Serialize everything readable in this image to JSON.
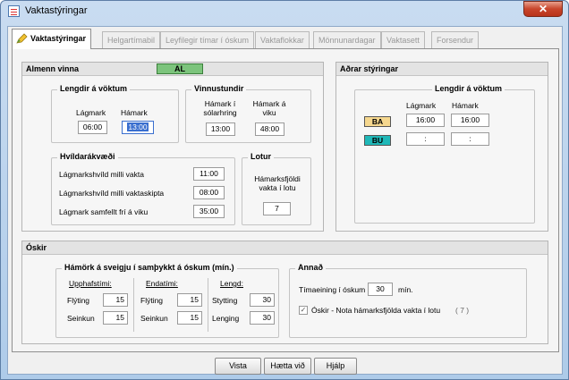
{
  "window": {
    "title": "Vaktastýringar",
    "close_glyph": "✕"
  },
  "tabs": [
    {
      "label": "Vaktastýringar"
    },
    {
      "label": "Helgartímabil"
    },
    {
      "label": "Leyfilegir tímar í óskum"
    },
    {
      "label": "Vaktaflokkar"
    },
    {
      "label": "Mönnunardagar"
    },
    {
      "label": "Vaktasett"
    },
    {
      "label": "Forsendur"
    }
  ],
  "almenn": {
    "title": "Almenn vinna",
    "badge": "AL",
    "lengdir": {
      "title": "Lengdir á vöktum",
      "min_label": "Lágmark",
      "max_label": "Hámark",
      "min_value": "06:00",
      "max_value": "13:00"
    },
    "vinnustundir": {
      "title": "Vinnustundir",
      "day_label": "Hámark í sólarhring",
      "week_label": "Hámark á viku",
      "day_value": "13:00",
      "week_value": "48:00"
    },
    "hvildar": {
      "title": "Hvíldarákvæði",
      "rows": [
        {
          "label": "Lágmarkshvíld milli vakta",
          "value": "11:00"
        },
        {
          "label": "Lágmarkshvíld milli vaktaskipta",
          "value": "08:00"
        },
        {
          "label": "Lágmark samfellt frí á viku",
          "value": "35:00"
        }
      ]
    },
    "lotur": {
      "title": "Lotur",
      "label": "Hámarksfjöldi vakta í lotu",
      "value": "7"
    }
  },
  "adrar": {
    "title": "Aðrar stýringar",
    "lengdir_title": "Lengdir á vöktum",
    "min_label": "Lágmark",
    "max_label": "Hámark",
    "rows": [
      {
        "tag": "BA",
        "min": "16:00",
        "max": "16:00",
        "color": "#f5d78e"
      },
      {
        "tag": "BU",
        "min": ":",
        "max": ":",
        "color": "#1fb8b8"
      }
    ]
  },
  "oskir": {
    "title": "Óskir",
    "hamork": {
      "title": "Hámörk á sveigju í samþykkt á óskum (mín.)",
      "upphaf": {
        "title": "Upphafstími:",
        "r1_label": "Flýting",
        "r1_value": "15",
        "r2_label": "Seinkun",
        "r2_value": "15"
      },
      "enda": {
        "title": "Endatími:",
        "r1_label": "Flýting",
        "r1_value": "15",
        "r2_label": "Seinkun",
        "r2_value": "15"
      },
      "lengd": {
        "title": "Lengd:",
        "r1_label": "Stytting",
        "r1_value": "30",
        "r2_label": "Lenging",
        "r2_value": "30"
      }
    },
    "annad": {
      "title": "Annað",
      "time_label": "Tímaeining í óskum",
      "time_value": "30",
      "time_unit": "mín.",
      "check_label": "Óskir - Nota hámarksfjölda vakta í lotu",
      "check_value": "( 7 )",
      "check_glyph": "✓"
    }
  },
  "buttons": {
    "vista": "Vista",
    "haetta": "Hætta við",
    "hjalp": "Hjálp"
  }
}
